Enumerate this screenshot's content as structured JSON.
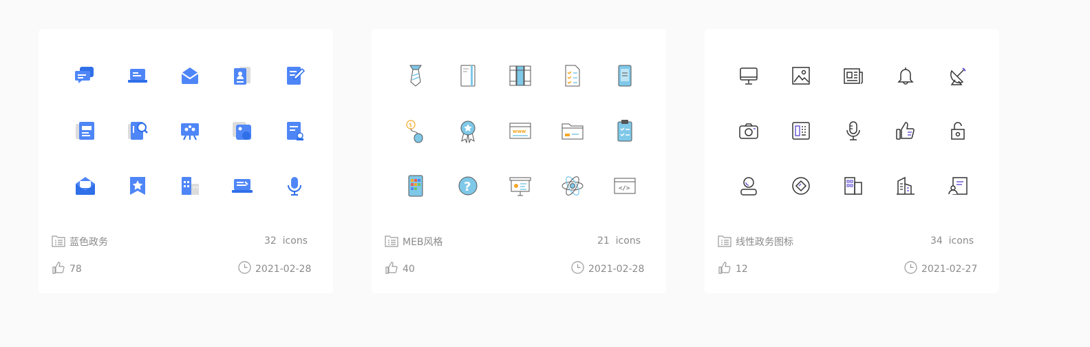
{
  "cards": [
    {
      "title": "蓝色政务",
      "count": "32",
      "count_unit": "icons",
      "likes": "78",
      "date": "2021-02-28",
      "style": "blue-filled",
      "accent": "#4f86f7",
      "icons": [
        "chat-icon",
        "laptop-icon",
        "mail-box-icon",
        "contact-card-icon",
        "document-edit-icon",
        "report-icon",
        "search-document-icon",
        "presentation-icon",
        "image-icon",
        "certificate-icon",
        "open-mail-icon",
        "star-bookmark-icon",
        "building-icon",
        "laptop-screen-icon",
        "microphone-icon"
      ]
    },
    {
      "title": "MEB风格",
      "count": "21",
      "count_unit": "icons",
      "likes": "40",
      "date": "2021-02-28",
      "style": "meb-color",
      "accent": "#7fc8e8",
      "icons": [
        "tie-icon",
        "book-icon",
        "books-icon",
        "checklist-icon",
        "phone-icon",
        "money-mouse-icon",
        "medal-icon",
        "www-browser-icon",
        "folder-icon",
        "clipboard-icon",
        "tablet-apps-icon",
        "question-icon",
        "projector-icon",
        "atom-icon",
        "code-window-icon"
      ]
    },
    {
      "title": "线性政务图标",
      "count": "34",
      "count_unit": "icons",
      "likes": "12",
      "date": "2021-02-27",
      "style": "line",
      "accent": "#333333",
      "icons": [
        "monitor-icon",
        "picture-icon",
        "newspaper-icon",
        "bell-icon",
        "satellite-icon",
        "camera-icon",
        "calculator-icon",
        "microphone-icon",
        "thumbs-up-icon",
        "unlock-icon",
        "user-icon",
        "diamond-circle-icon",
        "apps-building-icon",
        "city-icon",
        "certificate-user-icon"
      ]
    }
  ]
}
